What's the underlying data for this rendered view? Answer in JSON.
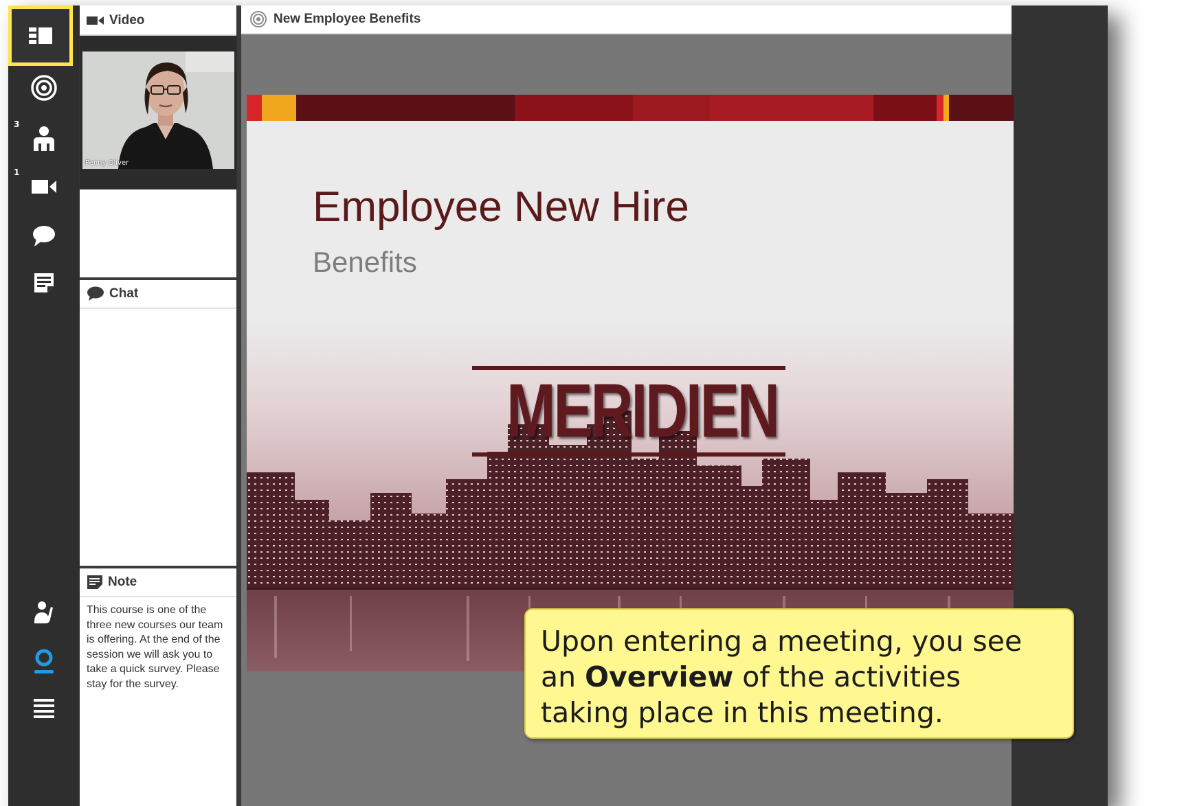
{
  "toolbar": {
    "items": [
      {
        "name": "overview",
        "icon": "layout-icon",
        "active": true
      },
      {
        "name": "share",
        "icon": "target-icon"
      },
      {
        "name": "attendees",
        "icon": "attendee-icon",
        "count": "3"
      },
      {
        "name": "video",
        "icon": "camera-icon",
        "count": "1"
      },
      {
        "name": "chat",
        "icon": "chat-bubble-icon"
      },
      {
        "name": "notes",
        "icon": "note-icon"
      },
      {
        "name": "raise-hand",
        "icon": "raise-hand-icon"
      },
      {
        "name": "profile",
        "icon": "user-status-icon"
      },
      {
        "name": "menu",
        "icon": "menu-icon"
      }
    ],
    "attendee_count": "3",
    "video_count": "1"
  },
  "pods": {
    "video": {
      "title": "Video",
      "participant_name": "Penny Oliver"
    },
    "chat": {
      "title": "Chat"
    },
    "note": {
      "title": "Note",
      "text": "This course is one of the three new courses our team is offering. At the end of the session we will ask you to take a quick survey. Please stay for the survey."
    },
    "share": {
      "title": "New Employee Benefits"
    }
  },
  "slide": {
    "title": "Employee New Hire",
    "subtitle": "Benefits",
    "logo": "MERIDIEN"
  },
  "callout": {
    "prefix": "Upon entering a meeting, you see an ",
    "bold": "Overview",
    "suffix": " of the activities taking place in this meeting."
  },
  "colors": {
    "highlight": "#ffe44d",
    "toolbar": "#2e2e2e",
    "brand_maroon": "#5a1a1c",
    "callout_bg": "#fff78f",
    "status_blue": "#1e9be8"
  }
}
